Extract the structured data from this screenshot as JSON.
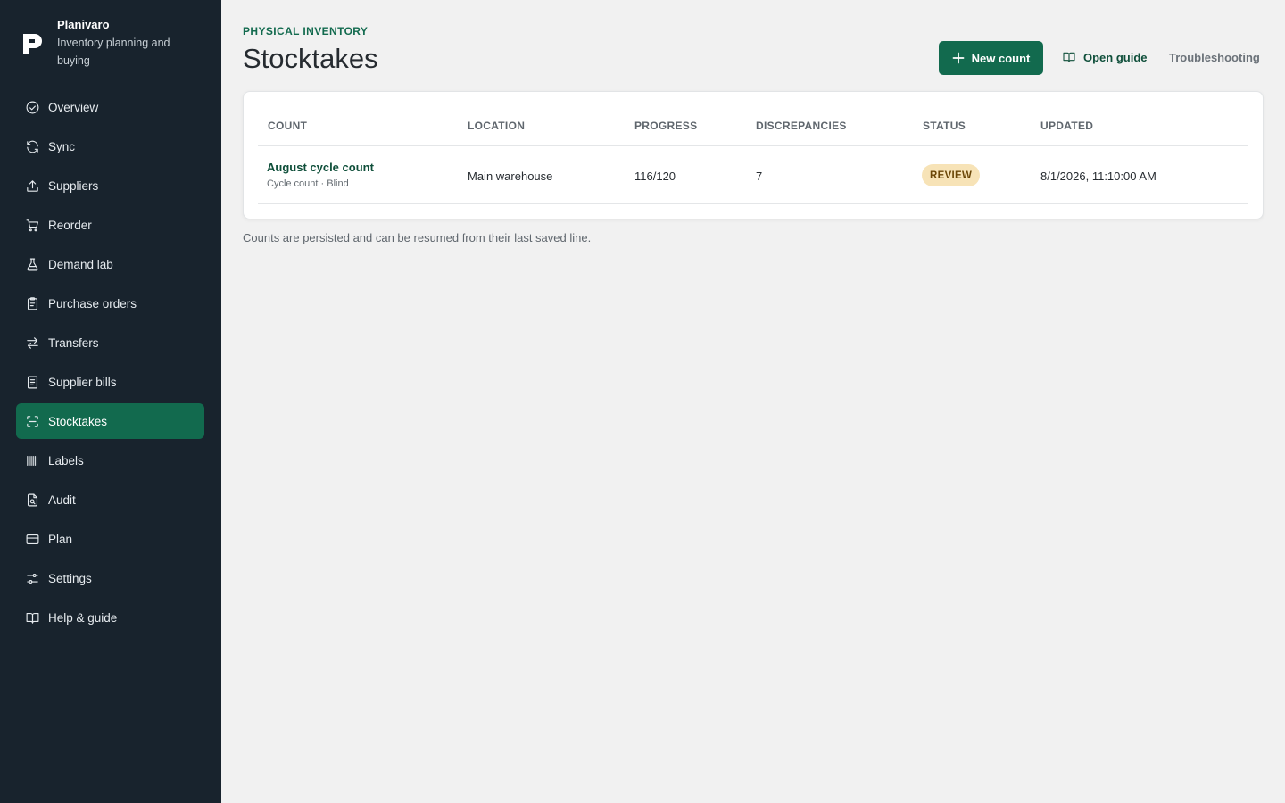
{
  "brand": {
    "name": "Planivaro",
    "subtitle": "Inventory planning and buying"
  },
  "sidebar": {
    "items": [
      {
        "label": "Overview",
        "icon": "check-circle-icon",
        "active": false
      },
      {
        "label": "Sync",
        "icon": "refresh-icon",
        "active": false
      },
      {
        "label": "Suppliers",
        "icon": "upload-icon",
        "active": false
      },
      {
        "label": "Reorder",
        "icon": "cart-icon",
        "active": false
      },
      {
        "label": "Demand lab",
        "icon": "flask-icon",
        "active": false
      },
      {
        "label": "Purchase orders",
        "icon": "clipboard-icon",
        "active": false
      },
      {
        "label": "Transfers",
        "icon": "arrows-swap-icon",
        "active": false
      },
      {
        "label": "Supplier bills",
        "icon": "receipt-icon",
        "active": false
      },
      {
        "label": "Stocktakes",
        "icon": "scan-icon",
        "active": true
      },
      {
        "label": "Labels",
        "icon": "barcode-icon",
        "active": false
      },
      {
        "label": "Audit",
        "icon": "file-search-icon",
        "active": false
      },
      {
        "label": "Plan",
        "icon": "credit-card-icon",
        "active": false
      },
      {
        "label": "Settings",
        "icon": "sliders-icon",
        "active": false
      },
      {
        "label": "Help & guide",
        "icon": "book-icon",
        "active": false
      }
    ]
  },
  "header": {
    "eyebrow": "PHYSICAL INVENTORY",
    "title": "Stocktakes",
    "new_count_label": "New count",
    "open_guide_label": "Open guide",
    "troubleshooting_label": "Troubleshooting"
  },
  "table": {
    "columns": [
      "COUNT",
      "LOCATION",
      "PROGRESS",
      "DISCREPANCIES",
      "STATUS",
      "UPDATED"
    ],
    "rows": [
      {
        "name": "August cycle count",
        "meta": "Cycle count · Blind",
        "location": "Main warehouse",
        "progress": "116/120",
        "discrepancies": "7",
        "status": "REVIEW",
        "updated": "8/1/2026, 11:10:00 AM"
      }
    ]
  },
  "footnote": "Counts are persisted and can be resumed from their last saved line.",
  "colors": {
    "sidebar_bg": "#18232d",
    "accent": "#126a4e",
    "status_review_bg": "#f7e3b7",
    "status_review_text": "#6b4708"
  }
}
